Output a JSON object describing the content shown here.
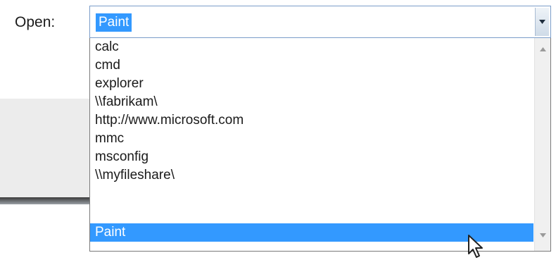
{
  "dialog": {
    "open_label": "Open:",
    "combo": {
      "value": "Paint"
    },
    "dropdown": {
      "items": [
        {
          "label": "calc"
        },
        {
          "label": "cmd"
        },
        {
          "label": "explorer"
        },
        {
          "label": "\\\\fabrikam\\"
        },
        {
          "label": "http://www.microsoft.com"
        },
        {
          "label": "mmc"
        },
        {
          "label": "msconfig"
        },
        {
          "label": "\\\\myfileshare\\"
        }
      ],
      "selected_item": {
        "label": "Paint"
      }
    }
  },
  "icons": {
    "combo_arrow": "chevron-down-icon",
    "scroll_up": "scroll-up-arrow-icon",
    "scroll_down": "scroll-down-arrow-icon",
    "cursor": "mouse-pointer-icon"
  },
  "colors": {
    "selection": "#3399ff",
    "combo_border": "#7a9cc9"
  }
}
